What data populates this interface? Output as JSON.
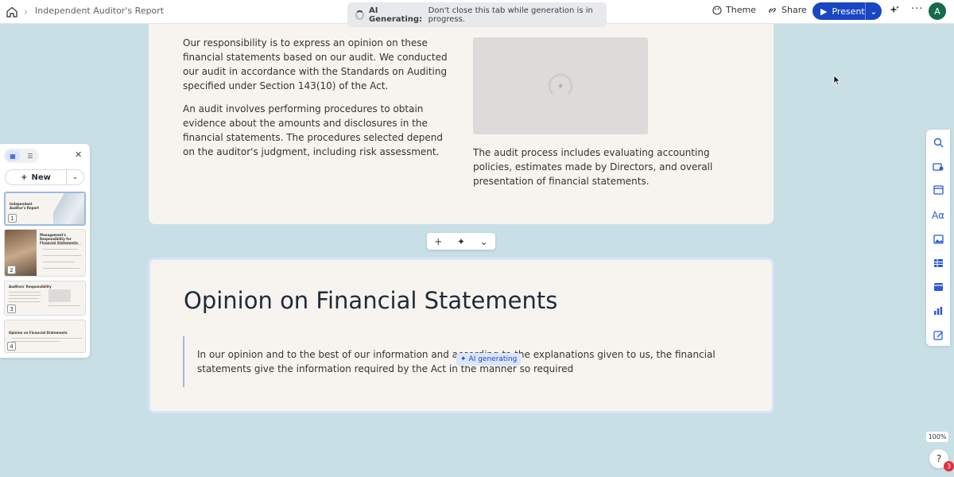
{
  "breadcrumb": {
    "title": "Independent Auditor's Report"
  },
  "ai_banner": {
    "label": "AI Generating:",
    "message": "Don't close this tab while generation is in progress."
  },
  "toolbar": {
    "theme_label": "Theme",
    "share_label": "Share",
    "present_label": "Present",
    "avatar_initial": "A"
  },
  "slide1": {
    "left_paragraphs": [
      "Our responsibility is to express an opinion on these financial statements based on our audit. We conducted our audit in accordance with the Standards on Auditing specified under Section 143(10) of the Act.",
      "An audit involves performing procedures to obtain evidence about the amounts and disclosures in the financial statements. The procedures selected depend on the auditor's judgment, including risk assessment."
    ],
    "right_paragraph": "The audit process includes evaluating accounting policies, estimates made by Directors, and overall presentation of financial statements."
  },
  "slide2": {
    "title": "Opinion on Financial Statements",
    "quote": "In our opinion and to the best of our information and according to the explanations given to us, the financial statements give the information required by the Act in the manner so required",
    "ai_badge": "AI generating"
  },
  "panel": {
    "new_label": "New",
    "thumbs": [
      {
        "num": "1",
        "title": "Independent Auditor's Report"
      },
      {
        "num": "2",
        "title": "Management's Responsibility for Financial Statements"
      },
      {
        "num": "3",
        "title": "Auditors' Responsibility"
      },
      {
        "num": "4",
        "title": "Opinion on Financial Statements"
      }
    ]
  },
  "zoom": "100%",
  "help": {
    "label": "?",
    "badge": "3"
  },
  "colors": {
    "accent": "#1a46c4",
    "canvas": "#c8dfe5",
    "slide": "#f7f4ef"
  }
}
